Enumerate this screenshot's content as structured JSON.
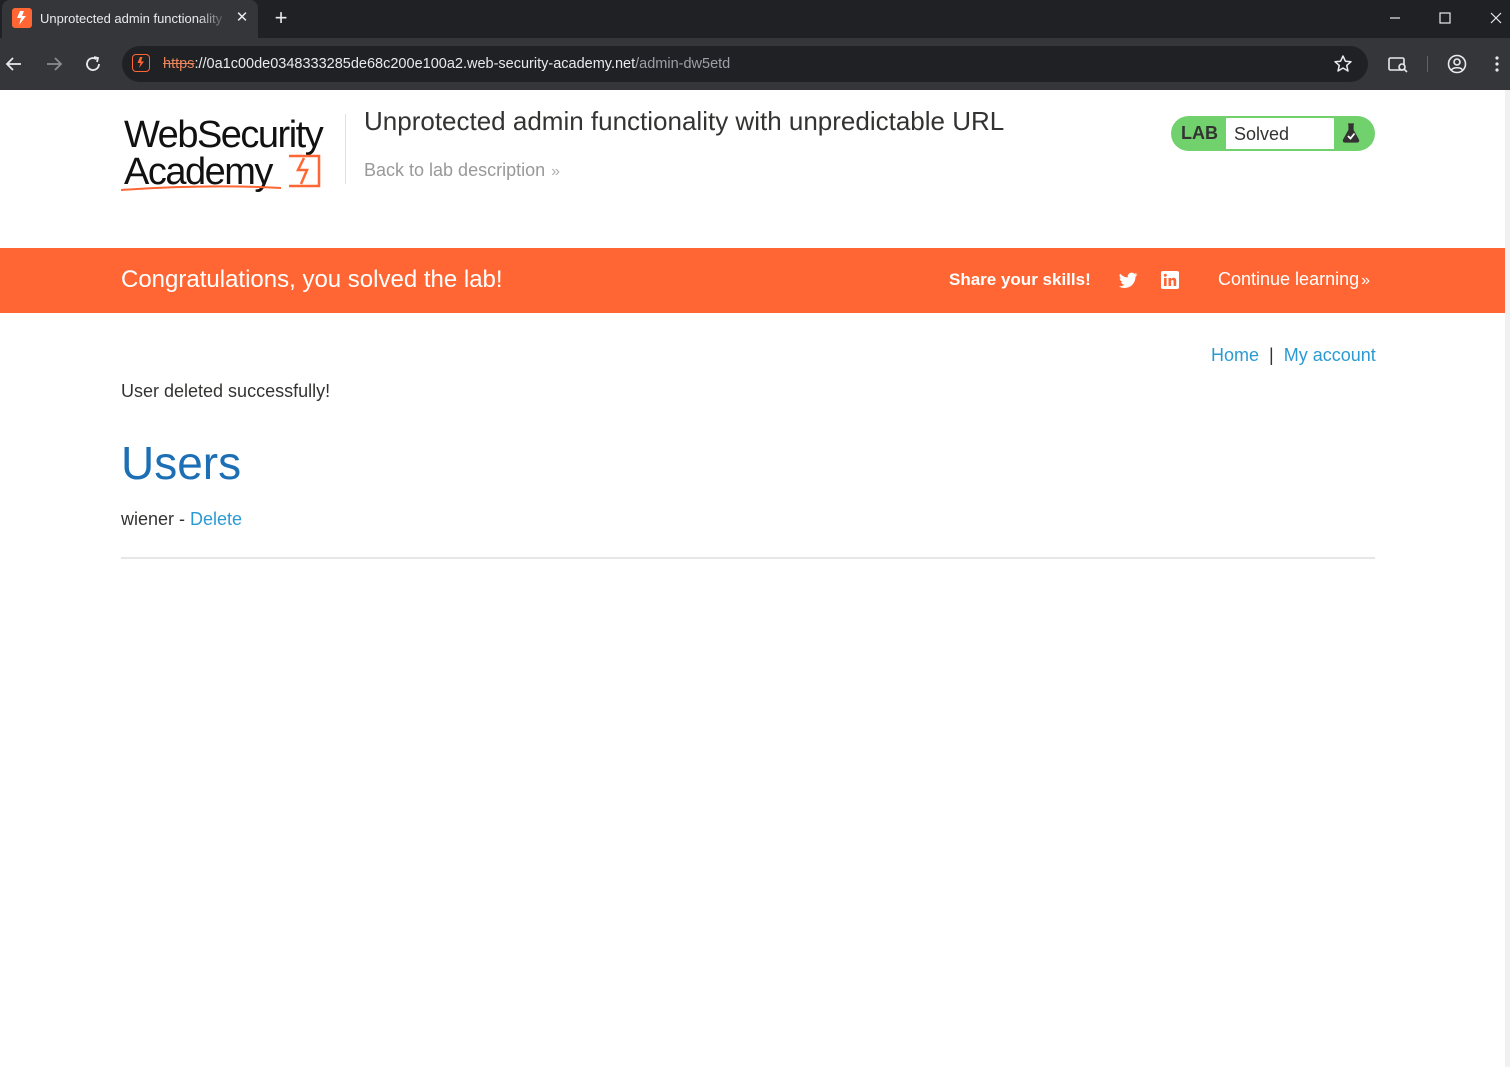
{
  "browser": {
    "tab_title": "Unprotected admin functionality with unpredictable URL",
    "tab_close": "✕",
    "new_tab": "+",
    "url": {
      "scheme": "https",
      "host": "://0a1c00de0348333285de68c200e100a2.web-security-academy.net",
      "path": "/admin-dw5etd"
    }
  },
  "header": {
    "logo_line1": "WebSecurity",
    "logo_line2": "Academy",
    "lab_title": "Unprotected admin functionality with unpredictable URL",
    "back_link": "Back to lab description",
    "lab_status": {
      "label": "LAB",
      "status": "Solved"
    }
  },
  "banner": {
    "message": "Congratulations, you solved the lab!",
    "share": "Share your skills!",
    "continue": "Continue learning"
  },
  "nav": {
    "home": "Home",
    "separator": "|",
    "my_account": "My account"
  },
  "main": {
    "message": "User deleted successfully!",
    "users_heading": "Users",
    "users": [
      {
        "name": "wiener",
        "separator": " - ",
        "action": "Delete"
      }
    ]
  },
  "colors": {
    "brand_orange": "#ff6633",
    "link_blue": "#2b9ad4",
    "heading_blue": "#1c6fb5",
    "solved_green": "#70d16d"
  }
}
